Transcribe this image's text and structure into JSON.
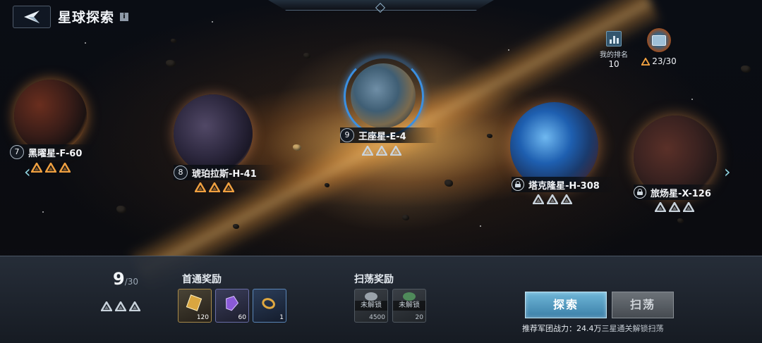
{
  "header": {
    "title": "星球探索",
    "info_badge": "i"
  },
  "ranking": {
    "label": "我的排名",
    "value": "10"
  },
  "chest": {
    "count": "23/30"
  },
  "planets": [
    {
      "level": "7",
      "name": "黑曜星-F-60",
      "stars_color": "#f0a040",
      "locked": false
    },
    {
      "level": "8",
      "name": "琥珀拉斯-H-41",
      "stars_color": "#f0a040",
      "locked": false
    },
    {
      "level": "9",
      "name": "王座星-E-4",
      "stars_color": "#c9d3dc",
      "locked": false,
      "selected": true
    },
    {
      "level": "",
      "name": "塔克隆星-H-308",
      "stars_color": "#c9d3dc",
      "locked": true
    },
    {
      "level": "",
      "name": "旅炀星-X-126",
      "stars_color": "#c9d3dc",
      "locked": true
    }
  ],
  "bottom": {
    "progress_value": "9",
    "progress_total": "/30",
    "first_clear_title": "首通奖励",
    "first_clear_items": [
      {
        "icon": "gold-card-icon",
        "count": "120"
      },
      {
        "icon": "purple-crystal-icon",
        "count": "60"
      },
      {
        "icon": "ring-icon",
        "count": "1"
      }
    ],
    "sweep_title": "扫荡奖励",
    "sweep_items": [
      {
        "icon": "silver-ore-icon",
        "lock_text": "未解锁",
        "count": "4500"
      },
      {
        "icon": "green-ore-icon",
        "lock_text": "未解锁",
        "count": "20"
      }
    ],
    "explore_button": "探索",
    "sweep_button": "扫荡",
    "recommend_prefix": "推荐军团战力：",
    "recommend_value": "24.4万",
    "recommend_hint": "三星通关解锁扫荡"
  },
  "colors": {
    "accent_blue": "#3b8fe0",
    "star_orange": "#f0a040",
    "star_grey": "#c9d3dc"
  }
}
